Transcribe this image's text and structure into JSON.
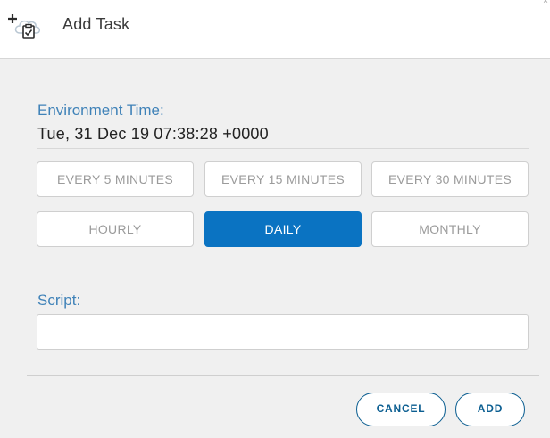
{
  "dialog": {
    "title": "Add Task",
    "close_glyph": "×",
    "header_icon": "add-task-cloud-clipboard-icon"
  },
  "environment": {
    "label": "Environment Time:",
    "value": "Tue, 31 Dec 19 07:38:28 +0000"
  },
  "frequency": {
    "options": [
      {
        "label": "EVERY 5 MINUTES",
        "selected": false
      },
      {
        "label": "EVERY 15 MINUTES",
        "selected": false
      },
      {
        "label": "EVERY 30 MINUTES",
        "selected": false
      },
      {
        "label": "HOURLY",
        "selected": false
      },
      {
        "label": "DAILY",
        "selected": true
      },
      {
        "label": "MONTHLY",
        "selected": false
      }
    ]
  },
  "script": {
    "label": "Script:",
    "value": "",
    "placeholder": ""
  },
  "actions": {
    "cancel_label": "CANCEL",
    "add_label": "ADD"
  },
  "colors": {
    "accent": "#0a73c2",
    "label_blue": "#3f82b8",
    "button_outline": "#0b5e91"
  }
}
